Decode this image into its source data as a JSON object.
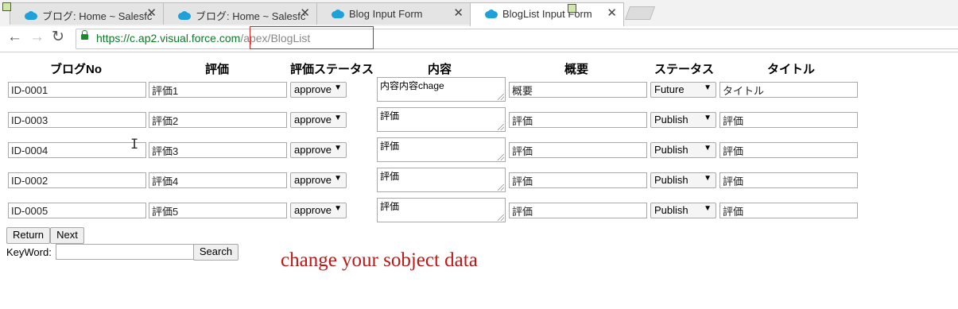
{
  "browser": {
    "tabs": [
      {
        "title": "ブログ: Home ~ Salesfc",
        "active": false,
        "favicon": "salesforce-cloud-icon"
      },
      {
        "title": "ブログ: Home ~ Salesfc",
        "active": false,
        "favicon": "salesforce-cloud-icon"
      },
      {
        "title": "Blog Input Form",
        "active": false,
        "favicon": "salesforce-cloud-icon"
      },
      {
        "title": "BlogList Input Form",
        "active": true,
        "favicon": "salesforce-cloud-icon"
      }
    ],
    "close_glyph": "✕",
    "nav": {
      "back": "←",
      "forward": "→",
      "reload": "↻"
    },
    "url_base": "https://c.ap2.visual.force.com",
    "url_path": "/apex/BlogList",
    "highlight_color": "#dd2222"
  },
  "table": {
    "headers": [
      "ブログNo",
      "評価",
      "評価ステータス",
      "内容",
      "概要",
      "ステータス",
      "タイトル"
    ],
    "rows": [
      {
        "blog_no": "ID-0001",
        "hyoka": "評価1",
        "hyoka_status": "approve",
        "naiyou": "内容内容chage",
        "gaiyou": "概要",
        "status": "Future",
        "title": "タイトル"
      },
      {
        "blog_no": "ID-0003",
        "hyoka": "評価2",
        "hyoka_status": "approve",
        "naiyou": "評価",
        "gaiyou": "評価",
        "status": "Publish",
        "title": "評価"
      },
      {
        "blog_no": "ID-0004",
        "hyoka": "評価3",
        "hyoka_status": "approve",
        "naiyou": "評価",
        "gaiyou": "評価",
        "status": "Publish",
        "title": "評価"
      },
      {
        "blog_no": "ID-0002",
        "hyoka": "評価4",
        "hyoka_status": "approve",
        "naiyou": "評価",
        "gaiyou": "評価",
        "status": "Publish",
        "title": "評価"
      },
      {
        "blog_no": "ID-0005",
        "hyoka": "評価5",
        "hyoka_status": "approve",
        "naiyou": "評価",
        "gaiyou": "評価",
        "status": "Publish",
        "title": "評価"
      }
    ],
    "dropdown_arrow": "▼"
  },
  "pager": {
    "return_label": "Return",
    "next_label": "Next"
  },
  "search": {
    "keyword_label": "KeyWord:",
    "keyword_value": "",
    "search_label": "Search"
  },
  "annotation": {
    "text": "change your sobject data",
    "color": "#c01616"
  },
  "cursor_glyph": "I"
}
